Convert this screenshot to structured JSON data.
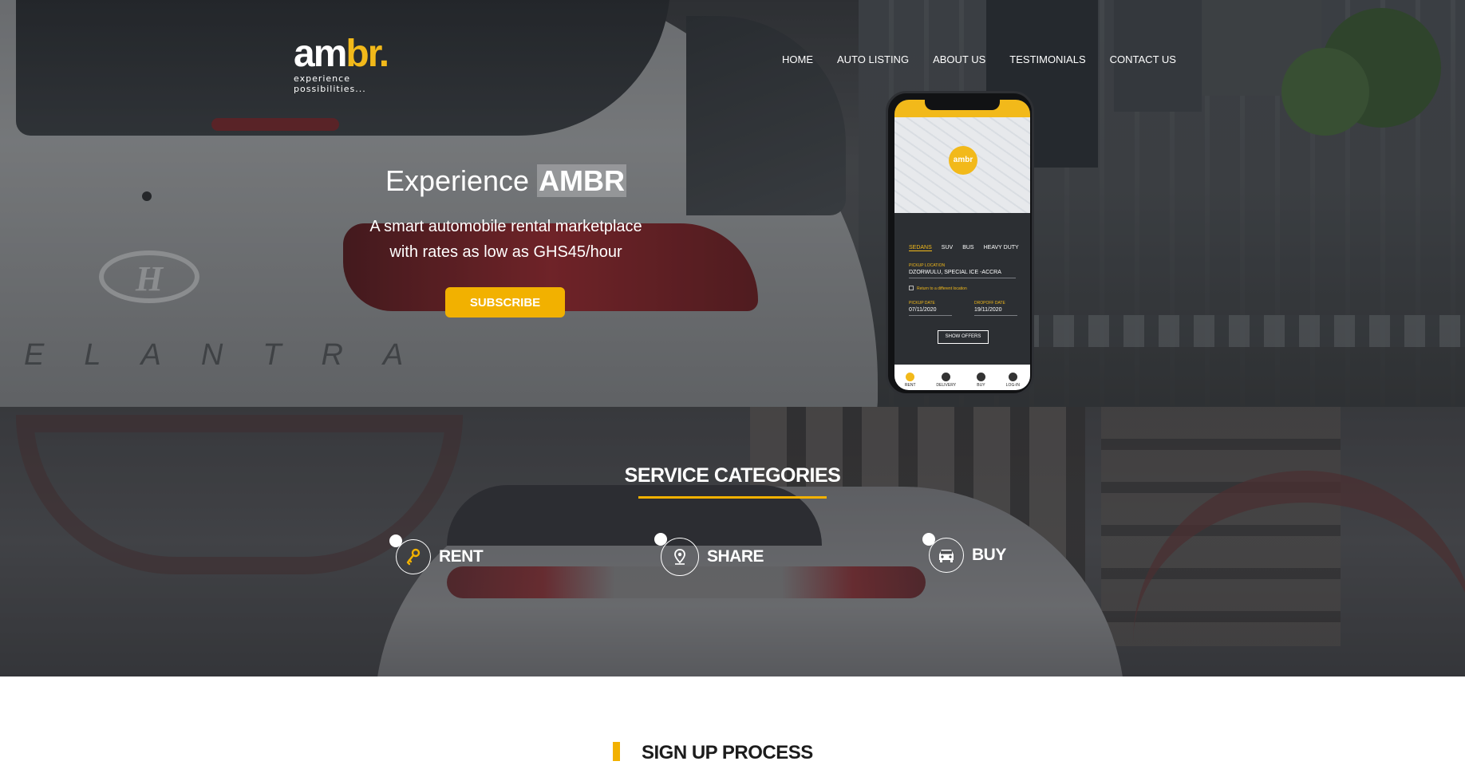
{
  "brand": {
    "logo_text_main": "am",
    "logo_text_accent": "br.",
    "tagline": "experience possibilities..."
  },
  "nav": {
    "items": [
      {
        "label": "HOME"
      },
      {
        "label": "AUTO LISTING"
      },
      {
        "label": "ABOUT US"
      },
      {
        "label": "TESTIMONIALS"
      },
      {
        "label": "CONTACT US"
      }
    ]
  },
  "hero": {
    "title_prefix": "Experience ",
    "title_highlight": "AMBR",
    "subtitle_line1": "A smart automobile rental marketplace",
    "subtitle_line2": "with rates as low as GHS45/hour",
    "subscribe_label": "SUBSCRIBE"
  },
  "phone": {
    "map_pin": "ambr",
    "tabs": [
      "SEDANS",
      "SUV",
      "BUS",
      "HEAVY DUTY"
    ],
    "pickup_label": "PICKUP LOCATION",
    "pickup_value": "DZORWULU, SPECIAL ICE -ACCRA",
    "return_label": "Return to a different location",
    "pickup_date_label": "PICKUP DATE",
    "pickup_date": "07/11/2020",
    "dropoff_date_label": "DROPOFF DATE",
    "dropoff_date": "19/11/2020",
    "show_offers": "SHOW OFFERS",
    "bottom_nav": [
      "RENT",
      "DELIVERY",
      "BUY",
      "LOG-IN"
    ]
  },
  "services": {
    "title": "SERVICE CATEGORIES",
    "items": [
      {
        "label": "RENT",
        "icon": "key-icon"
      },
      {
        "label": "SHARE",
        "icon": "location-pin-icon"
      },
      {
        "label": "BUY",
        "icon": "car-icon"
      }
    ]
  },
  "signup": {
    "title": "SIGN UP PROCESS"
  },
  "colors": {
    "accent": "#f2b100",
    "text_dark": "#1c1c1c",
    "text_light": "#ffffff"
  }
}
